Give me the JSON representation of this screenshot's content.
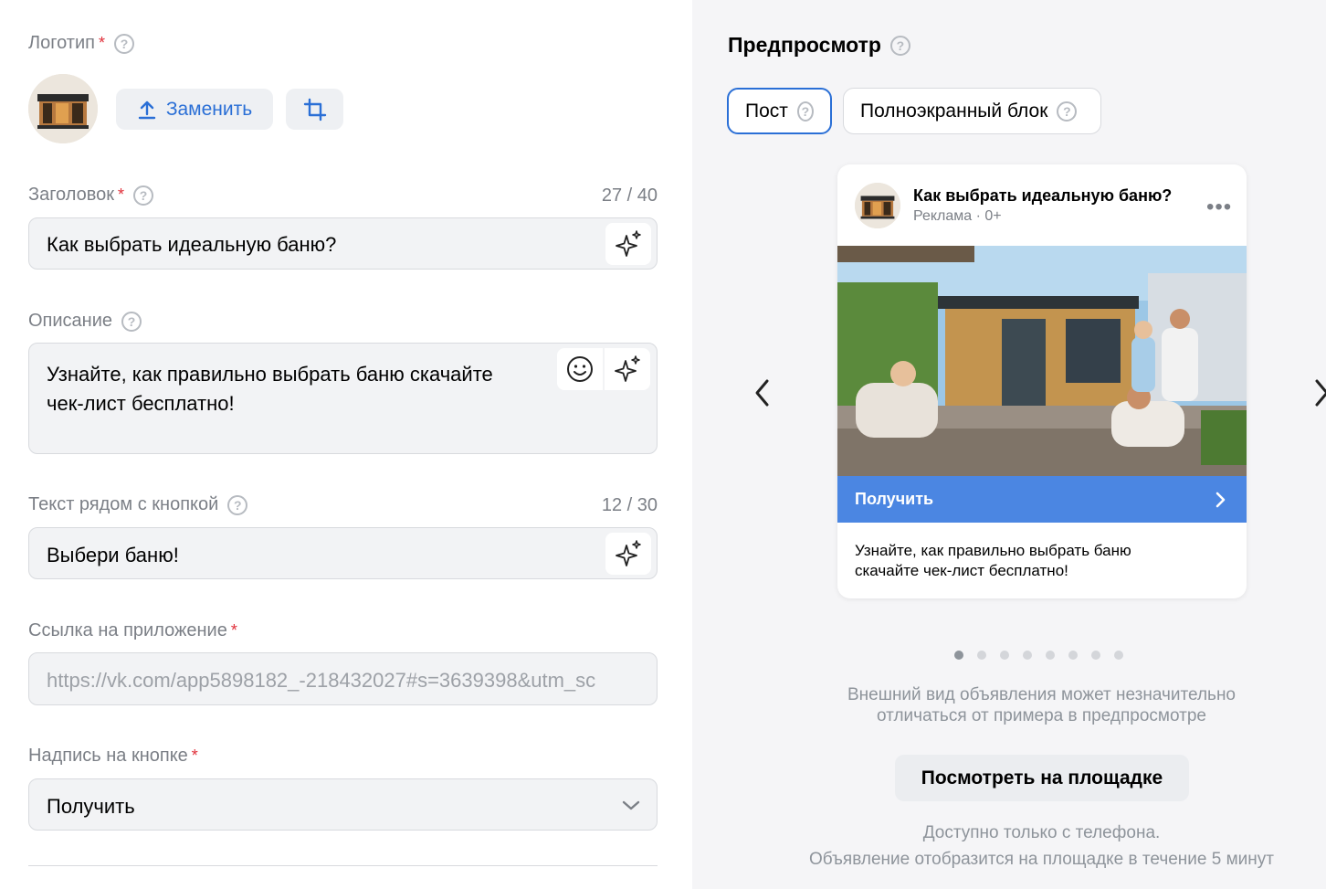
{
  "form": {
    "logo": {
      "label": "Логотип",
      "replace_label": "Заменить"
    },
    "headline": {
      "label": "Заголовок",
      "counter": "27 / 40",
      "value": "Как выбрать идеальную баню?"
    },
    "description": {
      "label": "Описание",
      "value_line1": "Узнайте, как правильно выбрать баню скачайте",
      "value_line2": "чек-лист бесплатно!"
    },
    "button_text": {
      "label": "Текст рядом с кнопкой",
      "counter": "12 / 30",
      "value": "Выбери баню!"
    },
    "app_link": {
      "label": "Ссылка на приложение",
      "value": "https://vk.com/app5898182_-218432027#s=3639398&utm_sc"
    },
    "button_caption": {
      "label": "Надпись на кнопке",
      "value": "Получить"
    }
  },
  "preview": {
    "title": "Предпросмотр",
    "tabs": [
      {
        "label": "Пост",
        "active": true
      },
      {
        "label": "Полноэкранный блок",
        "active": false
      }
    ],
    "card": {
      "title": "Как выбрать идеальную баню?",
      "subtitle": "Реклама · 0+",
      "cta": "Получить",
      "desc_line1": "Узнайте, как правильно выбрать баню",
      "desc_line2": "скачайте чек-лист бесплатно!"
    },
    "carousel": {
      "total": 8,
      "active_index": 0
    },
    "note_line1": "Внешний вид объявления может незначительно",
    "note_line2": "отличаться от примера в предпросмотре",
    "view_button": "Посмотреть на площадке",
    "footer_line1": "Доступно только с телефона.",
    "footer_line2": "Объявление отобразится на площадке в течение 5 минут"
  },
  "colors": {
    "accent": "#2a6fd6",
    "cta": "#4b86e2",
    "required": "#e0303a"
  },
  "icons": [
    "upload-icon",
    "crop-icon",
    "help-icon",
    "sparkle-icon",
    "emoji-icon",
    "chevron-down-icon",
    "chevron-left-icon",
    "chevron-right-icon",
    "more-icon"
  ]
}
